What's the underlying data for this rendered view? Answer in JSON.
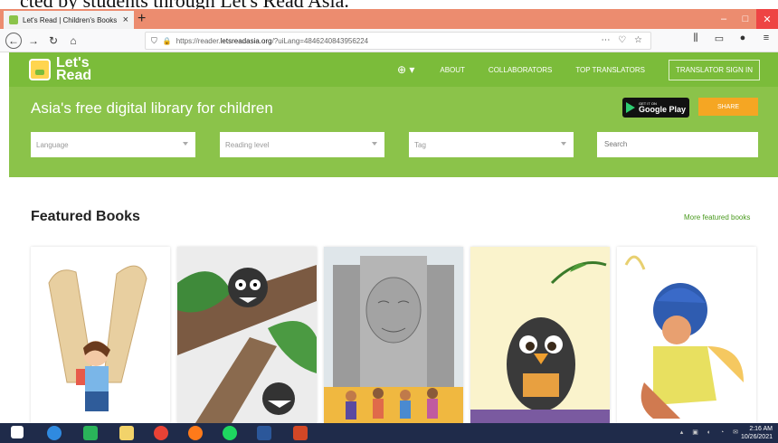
{
  "caption": "cted by students through Let's Read Asia.",
  "browser": {
    "tab_title": "Let's Read | Children's Books",
    "new_tab": "+",
    "url_prefix": "https://reader.",
    "url_domain": "letsreadasia.org",
    "url_suffix": "/?uiLang=4846240843956224",
    "url_actions": "⋯ ♡ ☆",
    "win_min": "–",
    "win_max": "□",
    "win_close": "✕"
  },
  "site": {
    "logo_line1": "Let's",
    "logo_line2": "Read",
    "nav": {
      "about": "ABOUT",
      "collaborators": "COLLABORATORS",
      "top_translators": "TOP TRANSLATORS",
      "signin": "TRANSLATOR SIGN IN"
    },
    "tagline": "Asia's free digital library for children",
    "gplay_small": "GET IT ON",
    "gplay_big": "Google Play",
    "share": "SHARE",
    "filters": {
      "language": "Language",
      "reading_level": "Reading level",
      "tag": "Tag",
      "search_placeholder": "Search"
    },
    "featured_title": "Featured Books",
    "more_featured": "More featured books"
  },
  "taskbar": {
    "time": "2:16 AM",
    "date": "10/26/2021"
  },
  "colors": {
    "header_green": "#7bbc3a",
    "hero_green": "#8bc34a",
    "share_orange": "#f5a623",
    "taskbar": "#1f2b4a"
  }
}
